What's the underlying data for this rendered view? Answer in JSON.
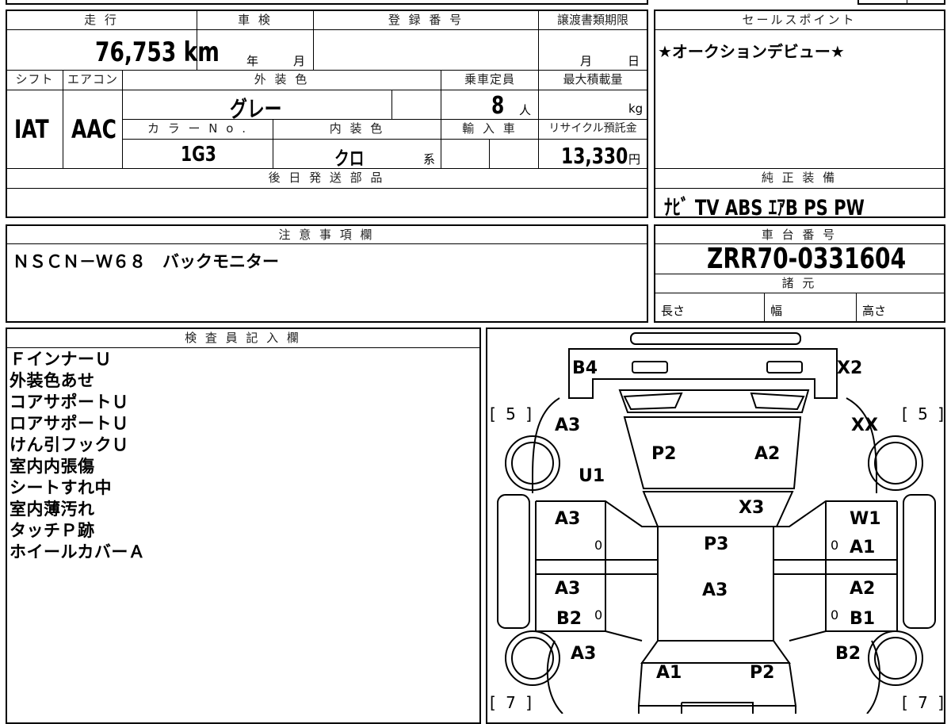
{
  "top_fields": {
    "mileage_header": "走 行",
    "shaken_header": "車 検",
    "registration_header": "登 録 番 号",
    "transfer_doc_header": "譲渡書類期限",
    "mileage_value": "76,753 km",
    "year_unit": "年",
    "month_unit": "月",
    "transfer_month_unit": "月",
    "transfer_day_unit": "日",
    "shift_header": "シフト",
    "ac_header": "エアコン",
    "exterior_color_header": "外 装 色",
    "capacity_header": "乗車定員",
    "max_load_header": "最大積載量",
    "shift_value": "IAT",
    "ac_value": "AAC",
    "exterior_color_value": "グレー",
    "capacity_value": "8",
    "capacity_unit": "人",
    "max_load_unit": "kg",
    "color_no_header": "カ ラ ー N o .",
    "interior_color_header": "内 装 色",
    "import_header": "輸 入 車",
    "recycle_header": "リサイクル預託金",
    "color_no_value": "1G3",
    "interior_color_value": "クロ",
    "interior_color_suffix": "系",
    "recycle_value": "13,330",
    "recycle_unit": "円",
    "later_parts_header": "後 日 発 送 部 品"
  },
  "sales_point": {
    "header": "セールスポイント",
    "text": "★オークションデビュー★"
  },
  "genuine_equipment": {
    "header": "純 正 装 備",
    "value": "ﾅﾋﾞ TV ABS ｴｱB PS PW"
  },
  "notes": {
    "header": "注 意 事 項 欄",
    "text": "ＮＳＣＮ－Ｗ６８　バックモニター"
  },
  "chassis": {
    "header": "車 台 番 号",
    "value": "ZRR70-0331604",
    "spec_header": "諸 元",
    "length_label": "長さ",
    "width_label": "幅",
    "height_label": "高さ"
  },
  "inspector": {
    "header": "検 査 員 記 入 欄",
    "lines": [
      "ＦインナーＵ",
      "外装色あせ",
      "コアサポートＵ",
      "ロアサポートＵ",
      "けん引フックＵ",
      "室内内張傷",
      "シートすれ中",
      "室内薄汚れ",
      "タッチＰ跡",
      "ホイールカバーＡ"
    ]
  },
  "diagram": {
    "tire_front_left": "[ 5 ]",
    "tire_front_right": "[ 5 ]",
    "tire_rear_left": "[ 7 ]",
    "tire_rear_right": "[ 7 ]",
    "marks": {
      "front_bumper_left": "B4",
      "front_bumper_right": "X2",
      "front_fender_left_a": "A3",
      "front_fender_left_u": "U1",
      "front_fender_right": "XX",
      "hood_left": "P2",
      "hood_right": "A2",
      "windshield": "X3",
      "front_door_left": "A3",
      "front_door_right_w": "W1",
      "front_door_right_a": "A1",
      "roof": "P3",
      "rear_door_left_a": "A3",
      "rear_door_left_b": "B2",
      "rear_door_right_a": "A2",
      "rear_door_right_b": "B1",
      "center_lower": "A3",
      "rear_fender_left": "A3",
      "rear_fender_right": "B2",
      "tailgate_left": "A1",
      "tailgate_right": "P2",
      "zero_fl": "0",
      "zero_fr": "0",
      "zero_rl": "0",
      "zero_rr": "0"
    }
  }
}
